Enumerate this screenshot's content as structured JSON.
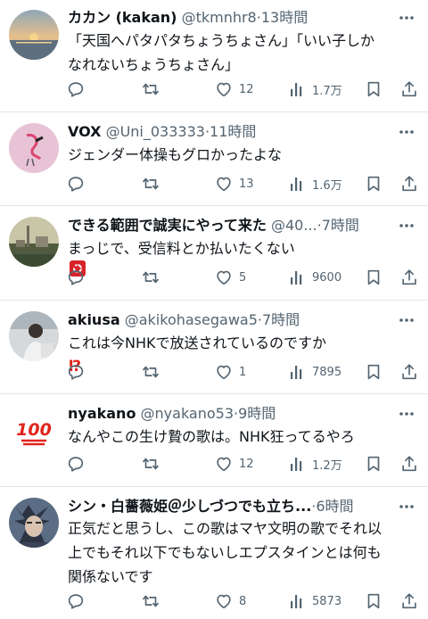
{
  "tweets": [
    {
      "name": "カカン (kakan)",
      "handle": "@tkmnhr8",
      "time": "13時間",
      "lines": [
        "「天国へパタパタちょうちょさん」「いい子しか",
        "なれないちょうちょさん」"
      ],
      "likes": "12",
      "views": "1.7万",
      "avatar": "sunset-avatar"
    },
    {
      "name": "VOX",
      "handle": "@Uni_033333",
      "time": "11時間",
      "lines": [
        "ジェンダー体操もグロかったよな"
      ],
      "likes": "13",
      "views": "1.6万",
      "avatar": "flamingo-avatar"
    },
    {
      "name": "できる範囲で誠実にやって来た",
      "handle": "@40...",
      "time": "7時間",
      "lines": [
        "まっじで、受信料とか払いたくない"
      ],
      "emoji": "anger-emoji",
      "likes": "5",
      "views": "9600",
      "avatar": "cityscape-avatar"
    },
    {
      "name": "akiusa",
      "handle": "@akikohasegawa5",
      "time": "7時間",
      "lines": [
        "これは今NHKで放送されているのですか"
      ],
      "emoji_text": "⁉",
      "likes": "1",
      "views": "7895",
      "avatar": "person-avatar"
    },
    {
      "name": "nyakano",
      "handle": "@nyakano53",
      "time": "9時間",
      "lines": [
        "なんやこの生け贄の歌は。NHK狂ってるやろ"
      ],
      "likes": "12",
      "views": "1.2万",
      "avatar": "hundred-avatar",
      "avatar_text": "100"
    },
    {
      "name": "シン・白薔薇姫＠少しづつでも立ち...",
      "handle": "",
      "time": "6時間",
      "lines": [
        "正気だと思うし、この歌はマヤ文明の歌でそれ以",
        "上でもそれ以下でもないしエプスタインとは何も",
        "関係ないです"
      ],
      "likes": "8",
      "views": "5873",
      "avatar": "anime-avatar"
    }
  ],
  "dot": "·",
  "colors": {
    "text": "#0f1419",
    "secondary": "#536471",
    "divider": "#e3e6e9"
  }
}
